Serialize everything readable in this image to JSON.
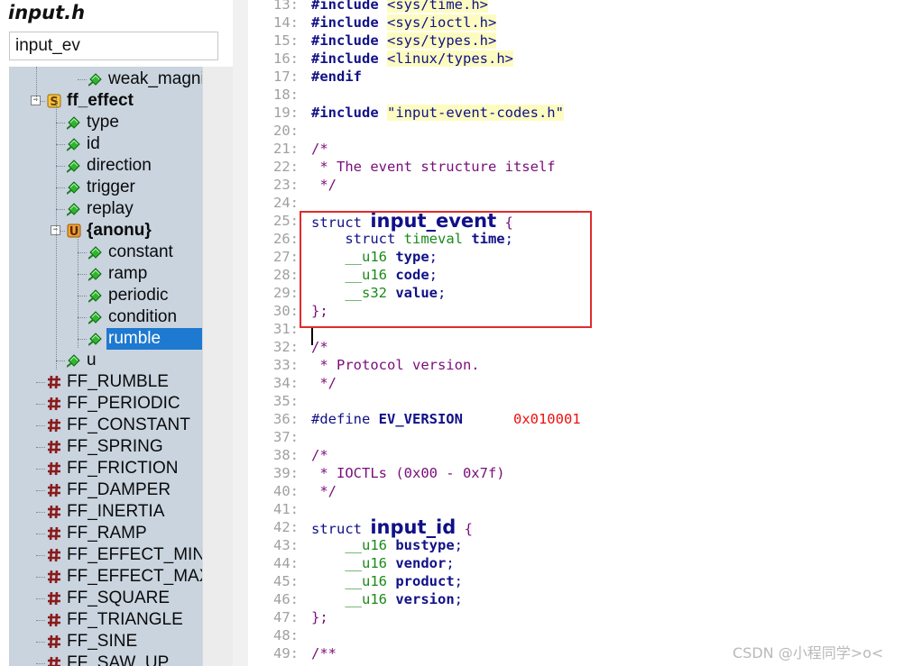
{
  "symbol_panel": {
    "file_title": "input.h",
    "filter_value": "input_ev",
    "tree_rows": [
      {
        "label": "weak_magnitu",
        "icon": "member-diamond-icon",
        "level": 3,
        "bold": false,
        "selected": false,
        "expander": ""
      },
      {
        "label": "ff_effect",
        "icon": "struct-s-icon",
        "level": 1,
        "bold": true,
        "selected": false,
        "expander": "-"
      },
      {
        "label": "type",
        "icon": "member-diamond-icon",
        "level": 2,
        "bold": false,
        "selected": false,
        "expander": ""
      },
      {
        "label": "id",
        "icon": "member-diamond-icon",
        "level": 2,
        "bold": false,
        "selected": false,
        "expander": ""
      },
      {
        "label": "direction",
        "icon": "member-diamond-icon",
        "level": 2,
        "bold": false,
        "selected": false,
        "expander": ""
      },
      {
        "label": "trigger",
        "icon": "member-diamond-icon",
        "level": 2,
        "bold": false,
        "selected": false,
        "expander": ""
      },
      {
        "label": "replay",
        "icon": "member-diamond-icon",
        "level": 2,
        "bold": false,
        "selected": false,
        "expander": ""
      },
      {
        "label": "{anonu}",
        "icon": "union-u-icon",
        "level": 2,
        "bold": true,
        "selected": false,
        "expander": "-"
      },
      {
        "label": "constant",
        "icon": "member-diamond-icon",
        "level": 3,
        "bold": false,
        "selected": false,
        "expander": ""
      },
      {
        "label": "ramp",
        "icon": "member-diamond-icon",
        "level": 3,
        "bold": false,
        "selected": false,
        "expander": ""
      },
      {
        "label": "periodic",
        "icon": "member-diamond-icon",
        "level": 3,
        "bold": false,
        "selected": false,
        "expander": ""
      },
      {
        "label": "condition",
        "icon": "member-diamond-icon",
        "level": 3,
        "bold": false,
        "selected": false,
        "expander": ""
      },
      {
        "label": "rumble",
        "icon": "member-diamond-icon",
        "level": 3,
        "bold": false,
        "selected": true,
        "expander": ""
      },
      {
        "label": "u",
        "icon": "member-diamond-icon",
        "level": 2,
        "bold": false,
        "selected": false,
        "expander": ""
      },
      {
        "label": "FF_RUMBLE",
        "icon": "macro-hash-icon",
        "level": 1,
        "bold": false,
        "selected": false,
        "expander": ""
      },
      {
        "label": "FF_PERIODIC",
        "icon": "macro-hash-icon",
        "level": 1,
        "bold": false,
        "selected": false,
        "expander": ""
      },
      {
        "label": "FF_CONSTANT",
        "icon": "macro-hash-icon",
        "level": 1,
        "bold": false,
        "selected": false,
        "expander": ""
      },
      {
        "label": "FF_SPRING",
        "icon": "macro-hash-icon",
        "level": 1,
        "bold": false,
        "selected": false,
        "expander": ""
      },
      {
        "label": "FF_FRICTION",
        "icon": "macro-hash-icon",
        "level": 1,
        "bold": false,
        "selected": false,
        "expander": ""
      },
      {
        "label": "FF_DAMPER",
        "icon": "macro-hash-icon",
        "level": 1,
        "bold": false,
        "selected": false,
        "expander": ""
      },
      {
        "label": "FF_INERTIA",
        "icon": "macro-hash-icon",
        "level": 1,
        "bold": false,
        "selected": false,
        "expander": ""
      },
      {
        "label": "FF_RAMP",
        "icon": "macro-hash-icon",
        "level": 1,
        "bold": false,
        "selected": false,
        "expander": ""
      },
      {
        "label": "FF_EFFECT_MIN",
        "icon": "macro-hash-icon",
        "level": 1,
        "bold": false,
        "selected": false,
        "expander": ""
      },
      {
        "label": "FF_EFFECT_MAX",
        "icon": "macro-hash-icon",
        "level": 1,
        "bold": false,
        "selected": false,
        "expander": ""
      },
      {
        "label": "FF_SQUARE",
        "icon": "macro-hash-icon",
        "level": 1,
        "bold": false,
        "selected": false,
        "expander": ""
      },
      {
        "label": "FF_TRIANGLE",
        "icon": "macro-hash-icon",
        "level": 1,
        "bold": false,
        "selected": false,
        "expander": ""
      },
      {
        "label": "FF_SINE",
        "icon": "macro-hash-icon",
        "level": 1,
        "bold": false,
        "selected": false,
        "expander": ""
      },
      {
        "label": "FF_SAW_UP",
        "icon": "macro-hash-icon",
        "level": 1,
        "bold": false,
        "selected": false,
        "expander": ""
      }
    ]
  },
  "editor": {
    "lines": [
      {
        "n": "13:",
        "segs": [
          [
            "dir",
            "#include "
          ],
          [
            "str",
            "<sys/time.h>"
          ]
        ]
      },
      {
        "n": "14:",
        "segs": [
          [
            "dir",
            "#include "
          ],
          [
            "str",
            "<sys/ioctl.h>"
          ]
        ]
      },
      {
        "n": "15:",
        "segs": [
          [
            "dir",
            "#include "
          ],
          [
            "str",
            "<sys/types.h>"
          ]
        ]
      },
      {
        "n": "16:",
        "segs": [
          [
            "dir",
            "#include "
          ],
          [
            "str",
            "<linux/types.h>"
          ]
        ]
      },
      {
        "n": "17:",
        "segs": [
          [
            "dir",
            "#endif"
          ]
        ]
      },
      {
        "n": "18:",
        "segs": []
      },
      {
        "n": "19:",
        "segs": [
          [
            "dir",
            "#include "
          ],
          [
            "str",
            "\"input-event-codes.h\""
          ]
        ]
      },
      {
        "n": "20:",
        "segs": []
      },
      {
        "n": "21:",
        "segs": [
          [
            "cmt",
            "/*"
          ]
        ]
      },
      {
        "n": "22:",
        "segs": [
          [
            "cmt",
            " * The event structure itself"
          ]
        ]
      },
      {
        "n": "23:",
        "segs": [
          [
            "cmt",
            " */"
          ]
        ]
      },
      {
        "n": "24:",
        "segs": []
      },
      {
        "n": "25:",
        "segs": [
          [
            "kw",
            "struct "
          ],
          [
            "big",
            "input_event"
          ],
          [
            "punc",
            " {"
          ]
        ]
      },
      {
        "n": "26:",
        "segs": [
          [
            "kw",
            "    struct "
          ],
          [
            "typ",
            "timeval "
          ],
          [
            "fld",
            "time"
          ],
          [
            "kw",
            ";"
          ]
        ]
      },
      {
        "n": "27:",
        "segs": [
          [
            "typ",
            "    __u16 "
          ],
          [
            "fld",
            "type"
          ],
          [
            "kw",
            ";"
          ]
        ]
      },
      {
        "n": "28:",
        "segs": [
          [
            "typ",
            "    __u16 "
          ],
          [
            "fld",
            "code"
          ],
          [
            "kw",
            ";"
          ]
        ]
      },
      {
        "n": "29:",
        "segs": [
          [
            "typ",
            "    __s32 "
          ],
          [
            "fld",
            "value"
          ],
          [
            "kw",
            ";"
          ]
        ]
      },
      {
        "n": "30:",
        "segs": [
          [
            "punc",
            "};"
          ]
        ]
      },
      {
        "n": "31:",
        "segs": []
      },
      {
        "n": "32:",
        "segs": [
          [
            "cmt",
            "/*"
          ]
        ]
      },
      {
        "n": "33:",
        "segs": [
          [
            "cmt",
            " * Protocol version."
          ]
        ]
      },
      {
        "n": "34:",
        "segs": [
          [
            "cmt",
            " */"
          ]
        ]
      },
      {
        "n": "35:",
        "segs": []
      },
      {
        "n": "36:",
        "segs": [
          [
            "kw",
            "#define "
          ],
          [
            "fld",
            "EV_VERSION"
          ],
          [
            "kw",
            "      "
          ],
          [
            "num",
            "0x010001"
          ]
        ]
      },
      {
        "n": "37:",
        "segs": []
      },
      {
        "n": "38:",
        "segs": [
          [
            "cmt",
            "/*"
          ]
        ]
      },
      {
        "n": "39:",
        "segs": [
          [
            "cmt",
            " * IOCTLs (0x00 - 0x7f)"
          ]
        ]
      },
      {
        "n": "40:",
        "segs": [
          [
            "cmt",
            " */"
          ]
        ]
      },
      {
        "n": "41:",
        "segs": []
      },
      {
        "n": "42:",
        "segs": [
          [
            "kw",
            "struct "
          ],
          [
            "big",
            "input_id"
          ],
          [
            "punc",
            " {"
          ]
        ]
      },
      {
        "n": "43:",
        "segs": [
          [
            "typ",
            "    __u16 "
          ],
          [
            "fld",
            "bustype"
          ],
          [
            "kw",
            ";"
          ]
        ]
      },
      {
        "n": "44:",
        "segs": [
          [
            "typ",
            "    __u16 "
          ],
          [
            "fld",
            "vendor"
          ],
          [
            "kw",
            ";"
          ]
        ]
      },
      {
        "n": "45:",
        "segs": [
          [
            "typ",
            "    __u16 "
          ],
          [
            "fld",
            "product"
          ],
          [
            "kw",
            ";"
          ]
        ]
      },
      {
        "n": "46:",
        "segs": [
          [
            "typ",
            "    __u16 "
          ],
          [
            "fld",
            "version"
          ],
          [
            "kw",
            ";"
          ]
        ]
      },
      {
        "n": "47:",
        "segs": [
          [
            "punc",
            "};"
          ]
        ]
      },
      {
        "n": "48:",
        "segs": []
      },
      {
        "n": "49:",
        "segs": [
          [
            "cmt",
            "/**"
          ]
        ]
      }
    ]
  },
  "watermark": "CSDN @小程同学>o<",
  "colors": {
    "selection": "#1e79d0",
    "highlight_box": "#e02b2b",
    "tree_bg": "#c9d4df"
  }
}
